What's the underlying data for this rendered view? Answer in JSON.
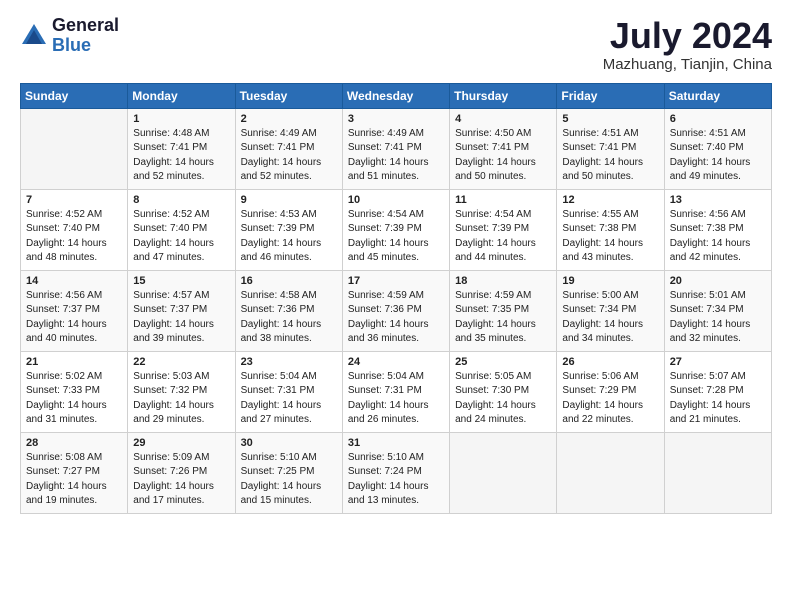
{
  "header": {
    "logo_general": "General",
    "logo_blue": "Blue",
    "title": "July 2024",
    "location": "Mazhuang, Tianjin, China"
  },
  "days_header": [
    "Sunday",
    "Monday",
    "Tuesday",
    "Wednesday",
    "Thursday",
    "Friday",
    "Saturday"
  ],
  "weeks": [
    [
      {
        "day": "",
        "sunrise": "",
        "sunset": "",
        "daylight": ""
      },
      {
        "day": "1",
        "sunrise": "Sunrise: 4:48 AM",
        "sunset": "Sunset: 7:41 PM",
        "daylight": "Daylight: 14 hours and 52 minutes."
      },
      {
        "day": "2",
        "sunrise": "Sunrise: 4:49 AM",
        "sunset": "Sunset: 7:41 PM",
        "daylight": "Daylight: 14 hours and 52 minutes."
      },
      {
        "day": "3",
        "sunrise": "Sunrise: 4:49 AM",
        "sunset": "Sunset: 7:41 PM",
        "daylight": "Daylight: 14 hours and 51 minutes."
      },
      {
        "day": "4",
        "sunrise": "Sunrise: 4:50 AM",
        "sunset": "Sunset: 7:41 PM",
        "daylight": "Daylight: 14 hours and 50 minutes."
      },
      {
        "day": "5",
        "sunrise": "Sunrise: 4:51 AM",
        "sunset": "Sunset: 7:41 PM",
        "daylight": "Daylight: 14 hours and 50 minutes."
      },
      {
        "day": "6",
        "sunrise": "Sunrise: 4:51 AM",
        "sunset": "Sunset: 7:40 PM",
        "daylight": "Daylight: 14 hours and 49 minutes."
      }
    ],
    [
      {
        "day": "7",
        "sunrise": "Sunrise: 4:52 AM",
        "sunset": "Sunset: 7:40 PM",
        "daylight": "Daylight: 14 hours and 48 minutes."
      },
      {
        "day": "8",
        "sunrise": "Sunrise: 4:52 AM",
        "sunset": "Sunset: 7:40 PM",
        "daylight": "Daylight: 14 hours and 47 minutes."
      },
      {
        "day": "9",
        "sunrise": "Sunrise: 4:53 AM",
        "sunset": "Sunset: 7:39 PM",
        "daylight": "Daylight: 14 hours and 46 minutes."
      },
      {
        "day": "10",
        "sunrise": "Sunrise: 4:54 AM",
        "sunset": "Sunset: 7:39 PM",
        "daylight": "Daylight: 14 hours and 45 minutes."
      },
      {
        "day": "11",
        "sunrise": "Sunrise: 4:54 AM",
        "sunset": "Sunset: 7:39 PM",
        "daylight": "Daylight: 14 hours and 44 minutes."
      },
      {
        "day": "12",
        "sunrise": "Sunrise: 4:55 AM",
        "sunset": "Sunset: 7:38 PM",
        "daylight": "Daylight: 14 hours and 43 minutes."
      },
      {
        "day": "13",
        "sunrise": "Sunrise: 4:56 AM",
        "sunset": "Sunset: 7:38 PM",
        "daylight": "Daylight: 14 hours and 42 minutes."
      }
    ],
    [
      {
        "day": "14",
        "sunrise": "Sunrise: 4:56 AM",
        "sunset": "Sunset: 7:37 PM",
        "daylight": "Daylight: 14 hours and 40 minutes."
      },
      {
        "day": "15",
        "sunrise": "Sunrise: 4:57 AM",
        "sunset": "Sunset: 7:37 PM",
        "daylight": "Daylight: 14 hours and 39 minutes."
      },
      {
        "day": "16",
        "sunrise": "Sunrise: 4:58 AM",
        "sunset": "Sunset: 7:36 PM",
        "daylight": "Daylight: 14 hours and 38 minutes."
      },
      {
        "day": "17",
        "sunrise": "Sunrise: 4:59 AM",
        "sunset": "Sunset: 7:36 PM",
        "daylight": "Daylight: 14 hours and 36 minutes."
      },
      {
        "day": "18",
        "sunrise": "Sunrise: 4:59 AM",
        "sunset": "Sunset: 7:35 PM",
        "daylight": "Daylight: 14 hours and 35 minutes."
      },
      {
        "day": "19",
        "sunrise": "Sunrise: 5:00 AM",
        "sunset": "Sunset: 7:34 PM",
        "daylight": "Daylight: 14 hours and 34 minutes."
      },
      {
        "day": "20",
        "sunrise": "Sunrise: 5:01 AM",
        "sunset": "Sunset: 7:34 PM",
        "daylight": "Daylight: 14 hours and 32 minutes."
      }
    ],
    [
      {
        "day": "21",
        "sunrise": "Sunrise: 5:02 AM",
        "sunset": "Sunset: 7:33 PM",
        "daylight": "Daylight: 14 hours and 31 minutes."
      },
      {
        "day": "22",
        "sunrise": "Sunrise: 5:03 AM",
        "sunset": "Sunset: 7:32 PM",
        "daylight": "Daylight: 14 hours and 29 minutes."
      },
      {
        "day": "23",
        "sunrise": "Sunrise: 5:04 AM",
        "sunset": "Sunset: 7:31 PM",
        "daylight": "Daylight: 14 hours and 27 minutes."
      },
      {
        "day": "24",
        "sunrise": "Sunrise: 5:04 AM",
        "sunset": "Sunset: 7:31 PM",
        "daylight": "Daylight: 14 hours and 26 minutes."
      },
      {
        "day": "25",
        "sunrise": "Sunrise: 5:05 AM",
        "sunset": "Sunset: 7:30 PM",
        "daylight": "Daylight: 14 hours and 24 minutes."
      },
      {
        "day": "26",
        "sunrise": "Sunrise: 5:06 AM",
        "sunset": "Sunset: 7:29 PM",
        "daylight": "Daylight: 14 hours and 22 minutes."
      },
      {
        "day": "27",
        "sunrise": "Sunrise: 5:07 AM",
        "sunset": "Sunset: 7:28 PM",
        "daylight": "Daylight: 14 hours and 21 minutes."
      }
    ],
    [
      {
        "day": "28",
        "sunrise": "Sunrise: 5:08 AM",
        "sunset": "Sunset: 7:27 PM",
        "daylight": "Daylight: 14 hours and 19 minutes."
      },
      {
        "day": "29",
        "sunrise": "Sunrise: 5:09 AM",
        "sunset": "Sunset: 7:26 PM",
        "daylight": "Daylight: 14 hours and 17 minutes."
      },
      {
        "day": "30",
        "sunrise": "Sunrise: 5:10 AM",
        "sunset": "Sunset: 7:25 PM",
        "daylight": "Daylight: 14 hours and 15 minutes."
      },
      {
        "day": "31",
        "sunrise": "Sunrise: 5:10 AM",
        "sunset": "Sunset: 7:24 PM",
        "daylight": "Daylight: 14 hours and 13 minutes."
      },
      {
        "day": "",
        "sunrise": "",
        "sunset": "",
        "daylight": ""
      },
      {
        "day": "",
        "sunrise": "",
        "sunset": "",
        "daylight": ""
      },
      {
        "day": "",
        "sunrise": "",
        "sunset": "",
        "daylight": ""
      }
    ]
  ]
}
